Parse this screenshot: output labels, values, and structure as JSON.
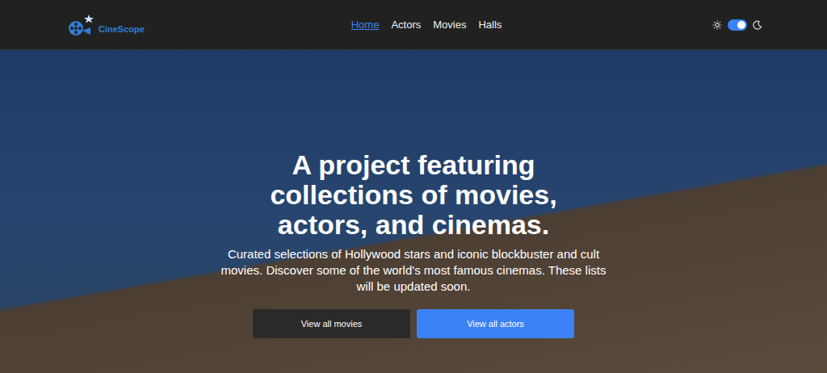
{
  "logo": {
    "text": "CineScope"
  },
  "nav": {
    "items": [
      {
        "label": "Home",
        "selected": true
      },
      {
        "label": "Actors",
        "selected": false
      },
      {
        "label": "Movies",
        "selected": false
      },
      {
        "label": "Halls",
        "selected": false
      }
    ]
  },
  "theme_toggle": {
    "on": true
  },
  "hero": {
    "title": "A project featuring collections of movies, actors, and cinemas.",
    "subtitle": "Curated selections of Hollywood stars and iconic blockbuster and cult movies. Discover some of the world's most famous cinemas. These lists will be updated soon.",
    "buttons": [
      {
        "label": "View all movies",
        "kind": "dark"
      },
      {
        "label": "View all actors",
        "kind": "primary"
      }
    ]
  }
}
